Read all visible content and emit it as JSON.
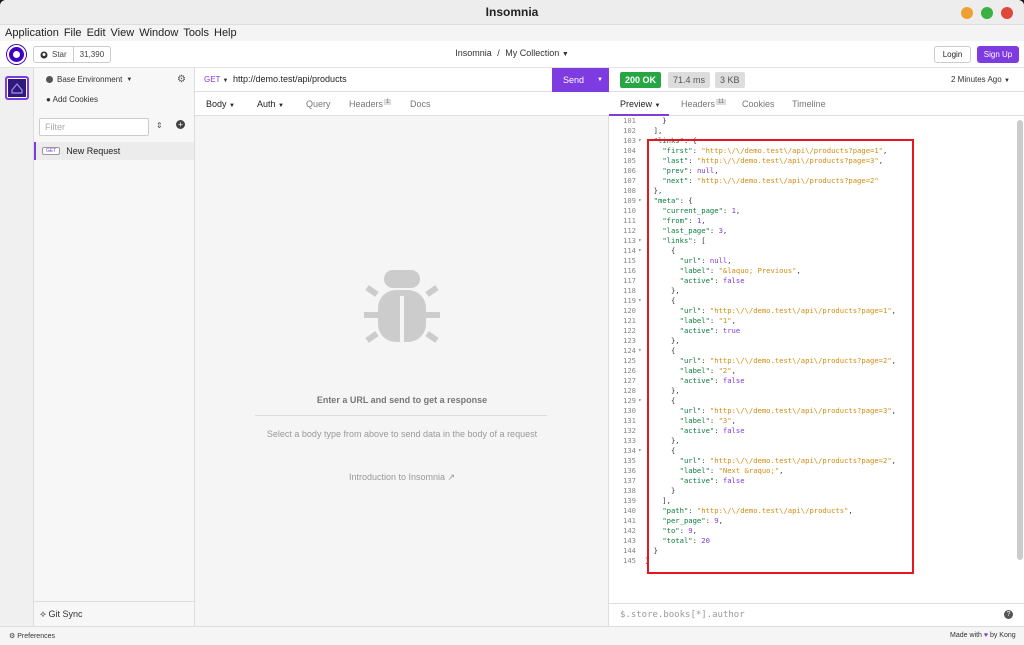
{
  "window": {
    "title": "Insomnia"
  },
  "menu": [
    "Application",
    "File",
    "Edit",
    "View",
    "Window",
    "Tools",
    "Help"
  ],
  "toolbar": {
    "star_label": "Star",
    "star_count": "31,390",
    "breadcrumb_app": "Insomnia",
    "breadcrumb_sep": "/",
    "breadcrumb_collection": "My Collection",
    "login": "Login",
    "signup": "Sign Up"
  },
  "sidebar": {
    "environment": "Base Environment",
    "add_cookies": "Add Cookies",
    "filter_placeholder": "Filter",
    "request_method": "GET",
    "request_name": "New Request",
    "git_sync": "Git Sync"
  },
  "request": {
    "method": "GET",
    "url": "http://demo.test/api/products",
    "send": "Send",
    "tabs": [
      "Body",
      "Auth",
      "Query",
      "Headers",
      "Docs"
    ],
    "headers_count": "1",
    "empty_title": "Enter a URL and send to get a response",
    "empty_hint": "Select a body type from above to send data in the body of a request",
    "intro_link": "Introduction to Insomnia"
  },
  "response": {
    "status": "200 OK",
    "time": "71.4 ms",
    "size": "3 KB",
    "when": "2 Minutes Ago",
    "tabs": [
      "Preview",
      "Headers",
      "Cookies",
      "Timeline"
    ],
    "headers_count": "11",
    "filter_placeholder": "$.store.books[*].author"
  },
  "statusbar": {
    "preferences": "Preferences",
    "made_with": "Made with",
    "by": "by Kong"
  },
  "colors": {
    "accent": "#7e3bdf",
    "success": "#27a744",
    "highlight_box": "#e8141e"
  },
  "code_lines": [
    {
      "n": "101",
      "f": "",
      "t": [
        [
          "p",
          "    }"
        ]
      ]
    },
    {
      "n": "102",
      "f": "",
      "t": [
        [
          "p",
          "  ],"
        ]
      ]
    },
    {
      "n": "103",
      "f": "▾",
      "t": [
        [
          "p",
          "  "
        ],
        [
          "k",
          "\"links\""
        ],
        [
          "p",
          ": {"
        ]
      ]
    },
    {
      "n": "104",
      "f": "",
      "t": [
        [
          "p",
          "    "
        ],
        [
          "k",
          "\"first\""
        ],
        [
          "p",
          ": "
        ],
        [
          "s",
          "\"http:\\/\\/demo.test\\/api\\/products?page=1\""
        ],
        [
          "p",
          ","
        ]
      ]
    },
    {
      "n": "105",
      "f": "",
      "t": [
        [
          "p",
          "    "
        ],
        [
          "k",
          "\"last\""
        ],
        [
          "p",
          ": "
        ],
        [
          "s",
          "\"http:\\/\\/demo.test\\/api\\/products?page=3\""
        ],
        [
          "p",
          ","
        ]
      ]
    },
    {
      "n": "106",
      "f": "",
      "t": [
        [
          "p",
          "    "
        ],
        [
          "k",
          "\"prev\""
        ],
        [
          "p",
          ": "
        ],
        [
          "n",
          "null"
        ],
        [
          "p",
          ","
        ]
      ]
    },
    {
      "n": "107",
      "f": "",
      "t": [
        [
          "p",
          "    "
        ],
        [
          "k",
          "\"next\""
        ],
        [
          "p",
          ": "
        ],
        [
          "s",
          "\"http:\\/\\/demo.test\\/api\\/products?page=2\""
        ]
      ]
    },
    {
      "n": "108",
      "f": "",
      "t": [
        [
          "p",
          "  },"
        ]
      ]
    },
    {
      "n": "109",
      "f": "▾",
      "t": [
        [
          "p",
          "  "
        ],
        [
          "k",
          "\"meta\""
        ],
        [
          "p",
          ": {"
        ]
      ]
    },
    {
      "n": "110",
      "f": "",
      "t": [
        [
          "p",
          "    "
        ],
        [
          "k",
          "\"current_page\""
        ],
        [
          "p",
          ": "
        ],
        [
          "n",
          "1"
        ],
        [
          "p",
          ","
        ]
      ]
    },
    {
      "n": "111",
      "f": "",
      "t": [
        [
          "p",
          "    "
        ],
        [
          "k",
          "\"from\""
        ],
        [
          "p",
          ": "
        ],
        [
          "n",
          "1"
        ],
        [
          "p",
          ","
        ]
      ]
    },
    {
      "n": "112",
      "f": "",
      "t": [
        [
          "p",
          "    "
        ],
        [
          "k",
          "\"last_page\""
        ],
        [
          "p",
          ": "
        ],
        [
          "n",
          "3"
        ],
        [
          "p",
          ","
        ]
      ]
    },
    {
      "n": "113",
      "f": "▾",
      "t": [
        [
          "p",
          "    "
        ],
        [
          "k",
          "\"links\""
        ],
        [
          "p",
          ": ["
        ]
      ]
    },
    {
      "n": "114",
      "f": "▾",
      "t": [
        [
          "p",
          "      {"
        ]
      ]
    },
    {
      "n": "115",
      "f": "",
      "t": [
        [
          "p",
          "        "
        ],
        [
          "k",
          "\"url\""
        ],
        [
          "p",
          ": "
        ],
        [
          "n",
          "null"
        ],
        [
          "p",
          ","
        ]
      ]
    },
    {
      "n": "116",
      "f": "",
      "t": [
        [
          "p",
          "        "
        ],
        [
          "k",
          "\"label\""
        ],
        [
          "p",
          ": "
        ],
        [
          "s",
          "\"&laquo; Previous\""
        ],
        [
          "p",
          ","
        ]
      ]
    },
    {
      "n": "117",
      "f": "",
      "t": [
        [
          "p",
          "        "
        ],
        [
          "k",
          "\"active\""
        ],
        [
          "p",
          ": "
        ],
        [
          "n",
          "false"
        ]
      ]
    },
    {
      "n": "118",
      "f": "",
      "t": [
        [
          "p",
          "      },"
        ]
      ]
    },
    {
      "n": "119",
      "f": "▾",
      "t": [
        [
          "p",
          "      {"
        ]
      ]
    },
    {
      "n": "120",
      "f": "",
      "t": [
        [
          "p",
          "        "
        ],
        [
          "k",
          "\"url\""
        ],
        [
          "p",
          ": "
        ],
        [
          "s",
          "\"http:\\/\\/demo.test\\/api\\/products?page=1\""
        ],
        [
          "p",
          ","
        ]
      ]
    },
    {
      "n": "121",
      "f": "",
      "t": [
        [
          "p",
          "        "
        ],
        [
          "k",
          "\"label\""
        ],
        [
          "p",
          ": "
        ],
        [
          "s",
          "\"1\""
        ],
        [
          "p",
          ","
        ]
      ]
    },
    {
      "n": "122",
      "f": "",
      "t": [
        [
          "p",
          "        "
        ],
        [
          "k",
          "\"active\""
        ],
        [
          "p",
          ": "
        ],
        [
          "n",
          "true"
        ]
      ]
    },
    {
      "n": "123",
      "f": "",
      "t": [
        [
          "p",
          "      },"
        ]
      ]
    },
    {
      "n": "124",
      "f": "▾",
      "t": [
        [
          "p",
          "      {"
        ]
      ]
    },
    {
      "n": "125",
      "f": "",
      "t": [
        [
          "p",
          "        "
        ],
        [
          "k",
          "\"url\""
        ],
        [
          "p",
          ": "
        ],
        [
          "s",
          "\"http:\\/\\/demo.test\\/api\\/products?page=2\""
        ],
        [
          "p",
          ","
        ]
      ]
    },
    {
      "n": "126",
      "f": "",
      "t": [
        [
          "p",
          "        "
        ],
        [
          "k",
          "\"label\""
        ],
        [
          "p",
          ": "
        ],
        [
          "s",
          "\"2\""
        ],
        [
          "p",
          ","
        ]
      ]
    },
    {
      "n": "127",
      "f": "",
      "t": [
        [
          "p",
          "        "
        ],
        [
          "k",
          "\"active\""
        ],
        [
          "p",
          ": "
        ],
        [
          "n",
          "false"
        ]
      ]
    },
    {
      "n": "128",
      "f": "",
      "t": [
        [
          "p",
          "      },"
        ]
      ]
    },
    {
      "n": "129",
      "f": "▾",
      "t": [
        [
          "p",
          "      {"
        ]
      ]
    },
    {
      "n": "130",
      "f": "",
      "t": [
        [
          "p",
          "        "
        ],
        [
          "k",
          "\"url\""
        ],
        [
          "p",
          ": "
        ],
        [
          "s",
          "\"http:\\/\\/demo.test\\/api\\/products?page=3\""
        ],
        [
          "p",
          ","
        ]
      ]
    },
    {
      "n": "131",
      "f": "",
      "t": [
        [
          "p",
          "        "
        ],
        [
          "k",
          "\"label\""
        ],
        [
          "p",
          ": "
        ],
        [
          "s",
          "\"3\""
        ],
        [
          "p",
          ","
        ]
      ]
    },
    {
      "n": "132",
      "f": "",
      "t": [
        [
          "p",
          "        "
        ],
        [
          "k",
          "\"active\""
        ],
        [
          "p",
          ": "
        ],
        [
          "n",
          "false"
        ]
      ]
    },
    {
      "n": "133",
      "f": "",
      "t": [
        [
          "p",
          "      },"
        ]
      ]
    },
    {
      "n": "134",
      "f": "▾",
      "t": [
        [
          "p",
          "      {"
        ]
      ]
    },
    {
      "n": "135",
      "f": "",
      "t": [
        [
          "p",
          "        "
        ],
        [
          "k",
          "\"url\""
        ],
        [
          "p",
          ": "
        ],
        [
          "s",
          "\"http:\\/\\/demo.test\\/api\\/products?page=2\""
        ],
        [
          "p",
          ","
        ]
      ]
    },
    {
      "n": "136",
      "f": "",
      "t": [
        [
          "p",
          "        "
        ],
        [
          "k",
          "\"label\""
        ],
        [
          "p",
          ": "
        ],
        [
          "s",
          "\"Next &raquo;\""
        ],
        [
          "p",
          ","
        ]
      ]
    },
    {
      "n": "137",
      "f": "",
      "t": [
        [
          "p",
          "        "
        ],
        [
          "k",
          "\"active\""
        ],
        [
          "p",
          ": "
        ],
        [
          "n",
          "false"
        ]
      ]
    },
    {
      "n": "138",
      "f": "",
      "t": [
        [
          "p",
          "      }"
        ]
      ]
    },
    {
      "n": "139",
      "f": "",
      "t": [
        [
          "p",
          "    ],"
        ]
      ]
    },
    {
      "n": "140",
      "f": "",
      "t": [
        [
          "p",
          "    "
        ],
        [
          "k",
          "\"path\""
        ],
        [
          "p",
          ": "
        ],
        [
          "s",
          "\"http:\\/\\/demo.test\\/api\\/products\""
        ],
        [
          "p",
          ","
        ]
      ]
    },
    {
      "n": "141",
      "f": "",
      "t": [
        [
          "p",
          "    "
        ],
        [
          "k",
          "\"per_page\""
        ],
        [
          "p",
          ": "
        ],
        [
          "n",
          "9"
        ],
        [
          "p",
          ","
        ]
      ]
    },
    {
      "n": "142",
      "f": "",
      "t": [
        [
          "p",
          "    "
        ],
        [
          "k",
          "\"to\""
        ],
        [
          "p",
          ": "
        ],
        [
          "n",
          "9"
        ],
        [
          "p",
          ","
        ]
      ]
    },
    {
      "n": "143",
      "f": "",
      "t": [
        [
          "p",
          "    "
        ],
        [
          "k",
          "\"total\""
        ],
        [
          "p",
          ": "
        ],
        [
          "n",
          "20"
        ]
      ]
    },
    {
      "n": "144",
      "f": "",
      "t": [
        [
          "p",
          "  }"
        ]
      ]
    },
    {
      "n": "145",
      "f": "",
      "t": [
        [
          "p",
          "}"
        ]
      ]
    }
  ]
}
